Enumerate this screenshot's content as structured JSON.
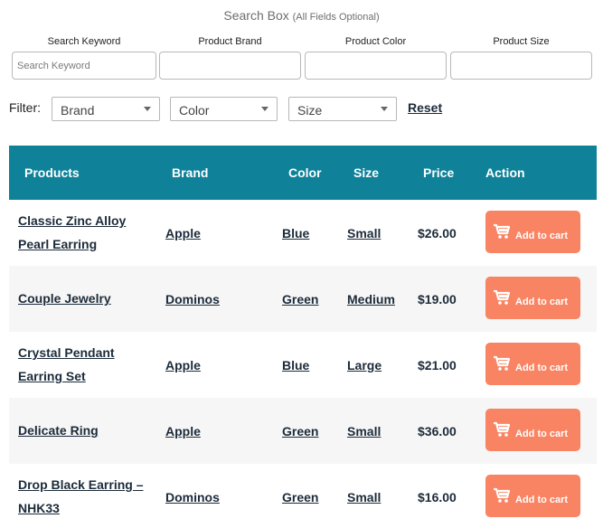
{
  "search": {
    "title": "Search Box",
    "subtitle": "(All Fields Optional)",
    "fields": [
      {
        "label": "Search Keyword",
        "placeholder": "Search Keyword",
        "value": ""
      },
      {
        "label": "Product Brand",
        "placeholder": "",
        "value": ""
      },
      {
        "label": "Product Color",
        "placeholder": "",
        "value": ""
      },
      {
        "label": "Product Size",
        "placeholder": "",
        "value": ""
      }
    ]
  },
  "filter": {
    "label": "Filter:",
    "selects": [
      "Brand",
      "Color",
      "Size"
    ],
    "reset_label": "Reset"
  },
  "table": {
    "headers": [
      "Products",
      "Brand",
      "Color",
      "Size",
      "Price",
      "Action"
    ],
    "header_color": "#0f8198",
    "button_color": "#f88463",
    "cart_icon": "cart-icon",
    "rows": [
      {
        "name_line1": "Classic Zinc Alloy",
        "name_line2": "Pearl Earring",
        "brand": "Apple",
        "color": "Blue",
        "size": "Small",
        "price": "$26.00",
        "action": "Add to cart"
      },
      {
        "name_line1": "Couple Jewelry",
        "name_line2": "",
        "brand": "Dominos",
        "color": "Green",
        "size": "Medium",
        "price": "$19.00",
        "action": "Add to cart"
      },
      {
        "name_line1": "Crystal Pendant",
        "name_line2": "Earring Set",
        "brand": "Apple",
        "color": "Blue",
        "size": "Large",
        "price": "$21.00",
        "action": "Add to cart"
      },
      {
        "name_line1": "Delicate Ring",
        "name_line2": "",
        "brand": "Apple",
        "color": "Green",
        "size": "Small",
        "price": "$36.00",
        "action": "Add to cart"
      },
      {
        "name_line1": "Drop Black Earring –",
        "name_line2": "NHK33",
        "brand": "Dominos",
        "color": "Green",
        "size": "Small",
        "price": "$16.00",
        "action": "Add to cart"
      }
    ]
  }
}
